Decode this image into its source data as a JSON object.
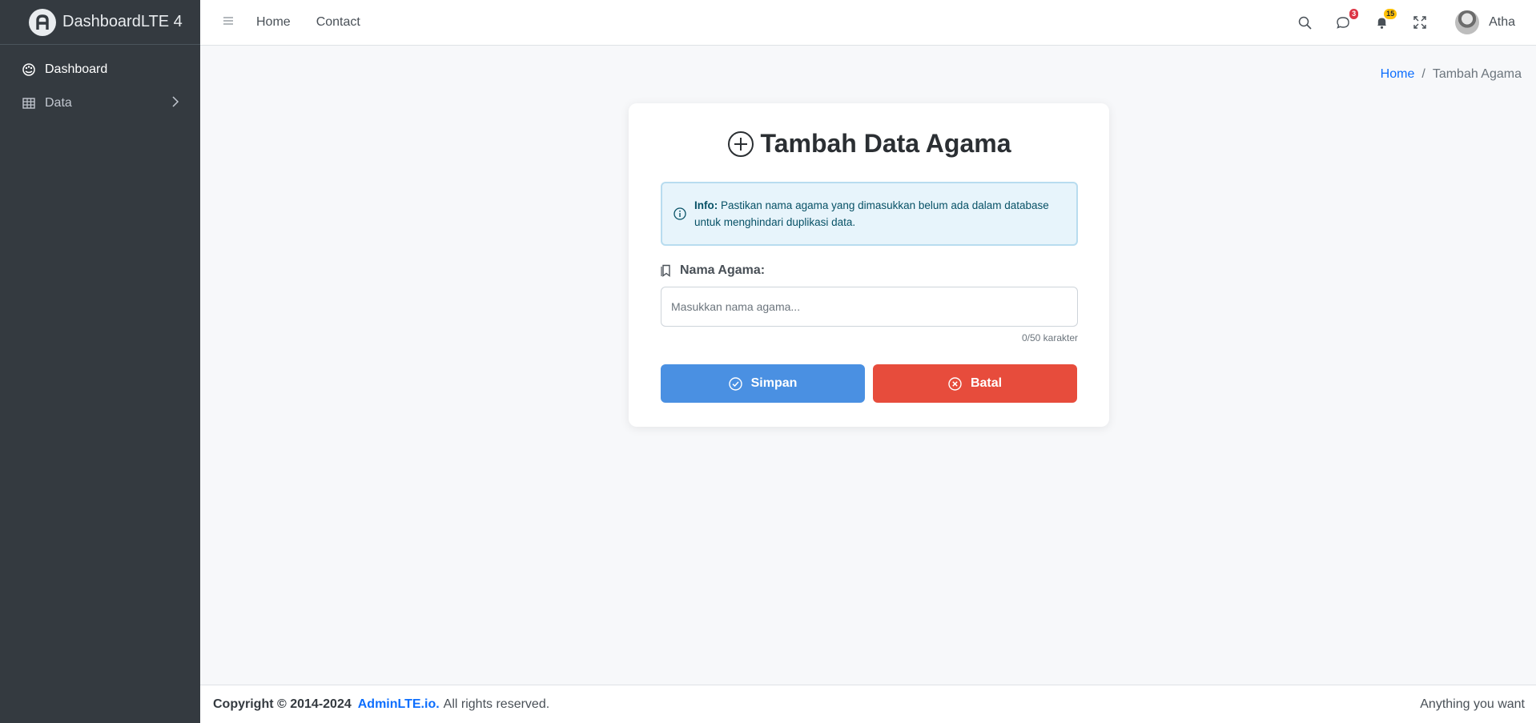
{
  "brand": {
    "name": "DashboardLTE 4"
  },
  "sidebar": {
    "items": [
      {
        "label": "Dashboard",
        "icon": "palette-icon"
      },
      {
        "label": "Data",
        "icon": "table-icon"
      }
    ]
  },
  "topbar": {
    "links": [
      "Home",
      "Contact"
    ],
    "messages_count": "3",
    "notifications_count": "15",
    "user_name": "Atha"
  },
  "breadcrumb": {
    "home": "Home",
    "current": "Tambah Agama"
  },
  "form": {
    "title": "Tambah Data Agama",
    "info_label": "Info:",
    "info_text": "Pastikan nama agama yang dimasukkan belum ada dalam database untuk menghindari duplikasi data.",
    "field_label": "Nama Agama:",
    "field_placeholder": "Masukkan nama agama...",
    "field_value": "",
    "counter": "0/50 karakter",
    "save_label": "Simpan",
    "cancel_label": "Batal"
  },
  "footer": {
    "copyright": "Copyright © 2014-2024",
    "brand_link": "AdminLTE.io.",
    "rights": "All rights reserved.",
    "right_text": "Anything you want"
  },
  "colors": {
    "sidebar_bg": "#343a40",
    "primary": "#4a90e2",
    "danger": "#e74c3c",
    "link": "#0d6efd",
    "info_bg": "#e7f4fb"
  }
}
